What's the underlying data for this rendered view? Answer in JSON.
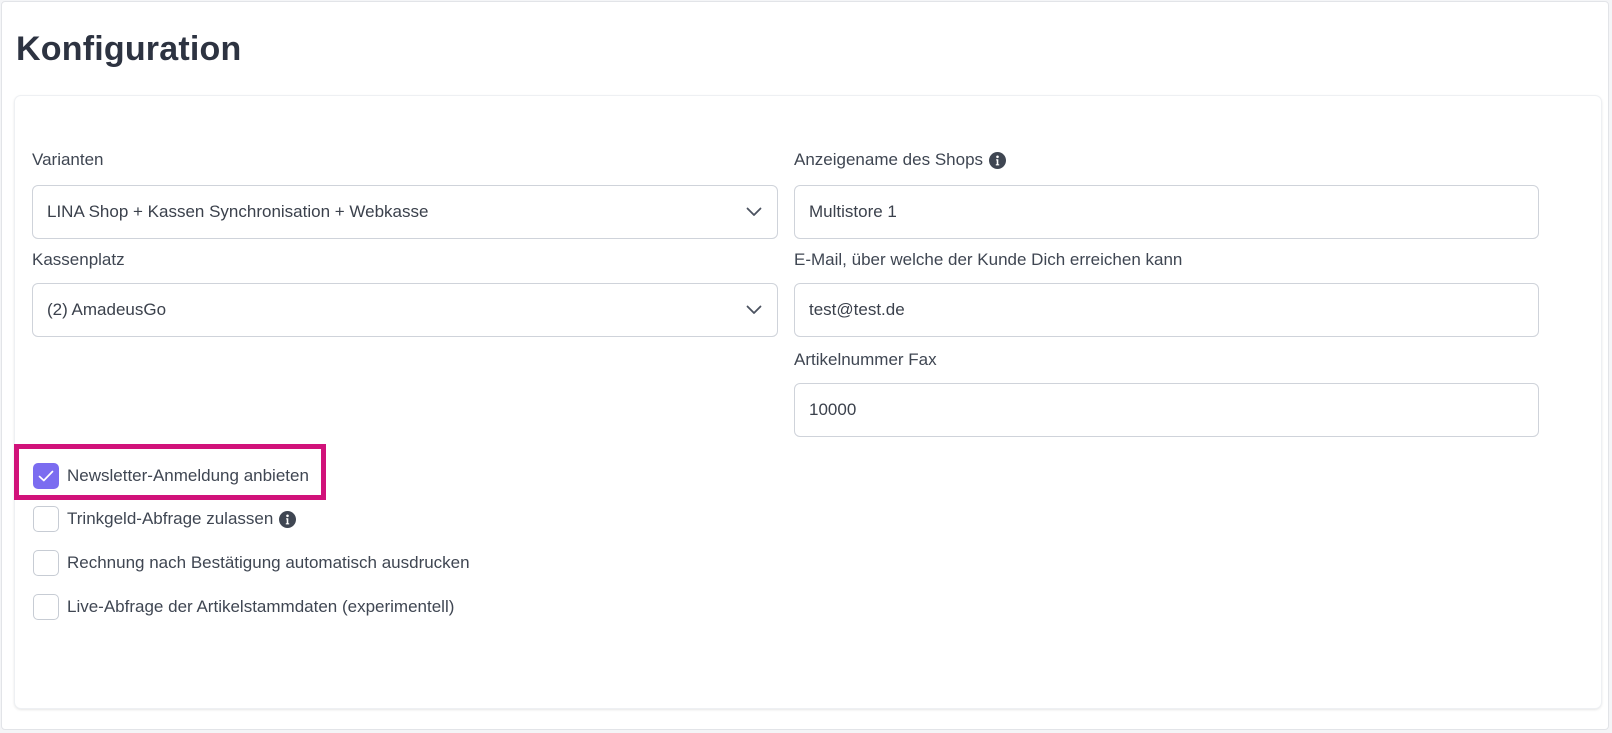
{
  "page": {
    "title": "Konfiguration"
  },
  "form": {
    "varianten": {
      "label": "Varianten",
      "value": "LINA Shop + Kassen Synchronisation + Webkasse"
    },
    "kassenplatz": {
      "label": "Kassenplatz",
      "value": "(2) AmadeusGo"
    },
    "shop_name": {
      "label": "Anzeigename des Shops",
      "value": "Multistore 1"
    },
    "email": {
      "label": "E-Mail, über welche der Kunde Dich erreichen kann",
      "value": "test@test.de"
    },
    "artikelnummer_fax": {
      "label": "Artikelnummer Fax",
      "value": "10000"
    }
  },
  "checkboxes": [
    {
      "label": "Newsletter-Anmeldung anbieten",
      "checked": true
    },
    {
      "label": "Trinkgeld-Abfrage zulassen",
      "checked": false
    },
    {
      "label": "Rechnung nach Bestätigung automatisch ausdrucken",
      "checked": false
    },
    {
      "label": "Live-Abfrage der Artikelstammdaten (experimentell)",
      "checked": false
    }
  ],
  "icons": {
    "info": "info-icon",
    "select_caret": "chevron-down-icon",
    "check": "checkmark-icon"
  },
  "colors": {
    "accent": "#7b6cf0",
    "highlight": "#d1127a",
    "title": "#2d3341"
  }
}
